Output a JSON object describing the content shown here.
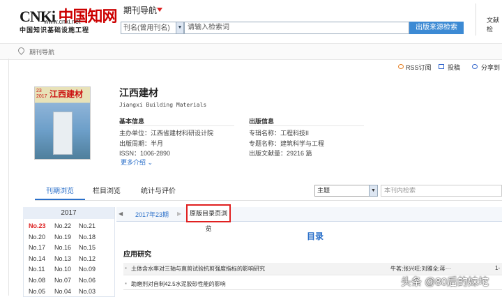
{
  "header": {
    "logo_main": "CNKi",
    "logo_cn": "中国知网",
    "logo_url": "www.cnki.net",
    "logo_tagline": "中国知识基础设施工程",
    "nav_title": "期刊导航",
    "search_scope": "刊名(曾用刊名)",
    "search_placeholder": "请输入检索词",
    "search_button": "出版来源检索",
    "right_link": "文献检"
  },
  "breadcrumb": {
    "label": "期刊导航"
  },
  "tools": {
    "rss": "RSS订阅",
    "submit": "投稿",
    "share": "分享到"
  },
  "journal": {
    "cover_title": "江西建材",
    "cover_issue": "23",
    "cover_year": "2017",
    "title": "江西建材",
    "title_en": "Jiangxi Building Materials",
    "basic_heading": "基本信息",
    "pub_heading": "出版信息",
    "sponsor": "主办单位：江西省建材科研设计院",
    "cycle": "出版周期：半月",
    "issn": "ISSN：1006-2890",
    "more": "更多介绍",
    "collection": "专辑名称：工程科技II",
    "subject": "专题名称：建筑科学与工程",
    "count": "出版文献量：29216 篇"
  },
  "tabs": [
    {
      "label": "刊期浏览"
    },
    {
      "label": "栏目浏览"
    },
    {
      "label": "统计与评价"
    }
  ],
  "filter": {
    "theme": "主题",
    "in_search_placeholder": "本刊内检索"
  },
  "years": {
    "current": "2017",
    "issues": [
      "No.23",
      "No.22",
      "No.21",
      "No.20",
      "No.19",
      "No.18",
      "No.17",
      "No.16",
      "No.15",
      "No.14",
      "No.13",
      "No.12",
      "No.11",
      "No.10",
      "No.09",
      "No.08",
      "No.07",
      "No.06",
      "No.05",
      "No.04",
      "No.03"
    ]
  },
  "issue_nav": {
    "label": "2017年23期",
    "orig_button": "原版目录页浏览"
  },
  "toc": {
    "title": "目录",
    "section": "应用研究",
    "articles": [
      {
        "title": "土体含水率对三轴与直剪试验抗剪强度指标的影响研究",
        "authors": "牛茗;张兴旺;刘雅全;蒋···",
        "page": "1-"
      },
      {
        "title": "助磨剂对自制42.5水泥胶砂性能的影响",
        "authors": "",
        "page": ""
      }
    ]
  },
  "watermark": "头条 @80后的妹坨"
}
